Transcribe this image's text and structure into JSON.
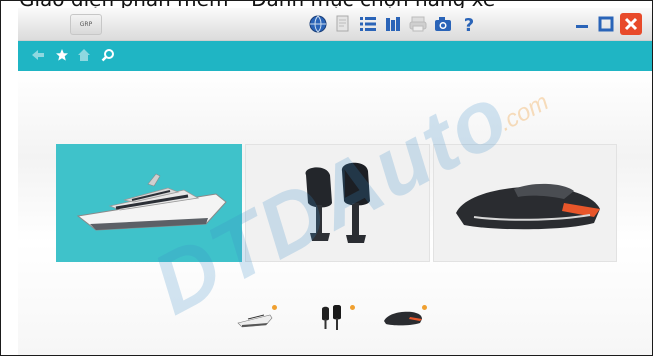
{
  "caption": "Giao diện phần mềm – Danh mục chọn hãng xe",
  "app": {
    "logo_text": "GRP"
  },
  "toolbar": {
    "buttons": [
      {
        "name": "globe-button",
        "icon": "globe-icon"
      },
      {
        "name": "document-button",
        "icon": "document-icon"
      },
      {
        "name": "list-button",
        "icon": "list-icon"
      },
      {
        "name": "library-button",
        "icon": "library-icon"
      },
      {
        "name": "print-button",
        "icon": "print-icon"
      },
      {
        "name": "camera-button",
        "icon": "camera-icon"
      },
      {
        "name": "help-button",
        "icon": "help-icon"
      }
    ],
    "window_controls": [
      "minimize",
      "maximize",
      "close"
    ]
  },
  "navbar": {
    "icons": [
      "back-arrow-icon",
      "star-icon",
      "home-icon",
      "search-icon"
    ]
  },
  "categories": [
    {
      "name": "yacht",
      "selected": true
    },
    {
      "name": "outboard-motor",
      "selected": false
    },
    {
      "name": "jet-ski",
      "selected": false
    }
  ],
  "watermark": {
    "brand": "DTDAuto",
    "domain": ".com"
  },
  "colors": {
    "accent": "#1fb5c4",
    "selected_panel": "#3fc2ca",
    "close": "#e84a2a",
    "dot": "#f0a030"
  }
}
